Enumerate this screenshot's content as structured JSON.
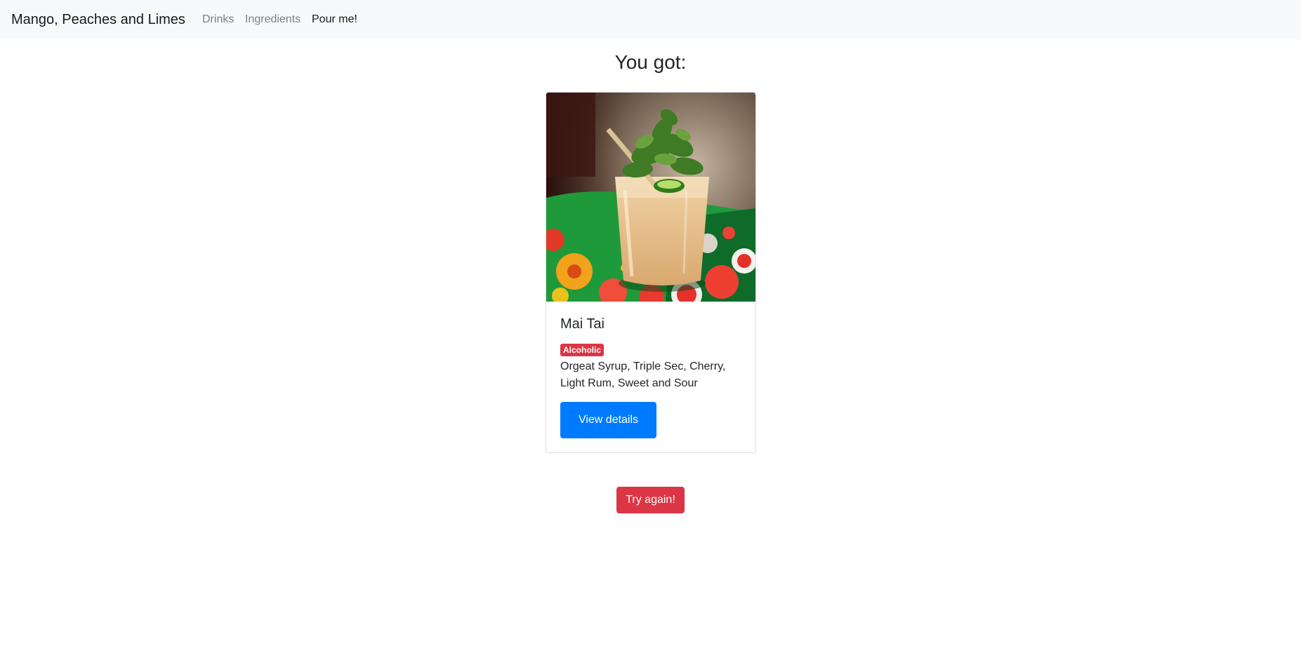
{
  "navbar": {
    "brand": "Mango, Peaches and Limes",
    "links": [
      {
        "label": "Drinks",
        "active": false
      },
      {
        "label": "Ingredients",
        "active": false
      },
      {
        "label": "Pour me!",
        "active": true
      }
    ]
  },
  "main": {
    "heading": "You got:",
    "drink": {
      "name": "Mai Tai",
      "badge": "Alcoholic",
      "ingredients": "Orgeat Syrup, Triple Sec, Cherry, Light Rum, Sweet and Sour",
      "image_alt": "Mai Tai cocktail with mint garnish on floral tablecloth",
      "details_button": "View details"
    },
    "try_again_button": "Try again!"
  },
  "colors": {
    "navbar_bg": "#f8f9fa",
    "primary": "#007bff",
    "danger": "#dc3545"
  }
}
